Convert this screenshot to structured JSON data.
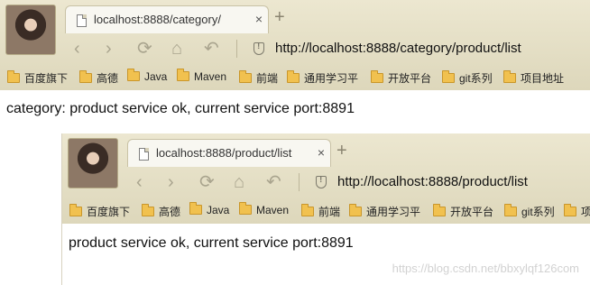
{
  "win1": {
    "tab_title": "localhost:8888/category/",
    "tab_close": "×",
    "new_tab": "+",
    "url": "http://localhost:8888/category/product/list",
    "bookmarks": [
      "百度旗下",
      "高德",
      "Java",
      "Maven",
      "前端",
      "通用学习平",
      "开放平台",
      "git系列",
      "项目地址"
    ],
    "page_text": "category: product service ok, current service port:8891"
  },
  "win2": {
    "tab_title": "localhost:8888/product/list",
    "tab_close": "×",
    "new_tab": "+",
    "url": "http://localhost:8888/product/list",
    "bookmarks": [
      "百度旗下",
      "高德",
      "Java",
      "Maven",
      "前端",
      "通用学习平",
      "开放平台",
      "git系列",
      "项"
    ],
    "page_text": "product service ok, current service port:8891"
  },
  "nav_icons": [
    "back-icon",
    "forward-icon",
    "reload-icon",
    "home-icon",
    "undo-icon",
    "shield-icon"
  ],
  "watermark": "https://blog.csdn.net/bbxylqf126com"
}
